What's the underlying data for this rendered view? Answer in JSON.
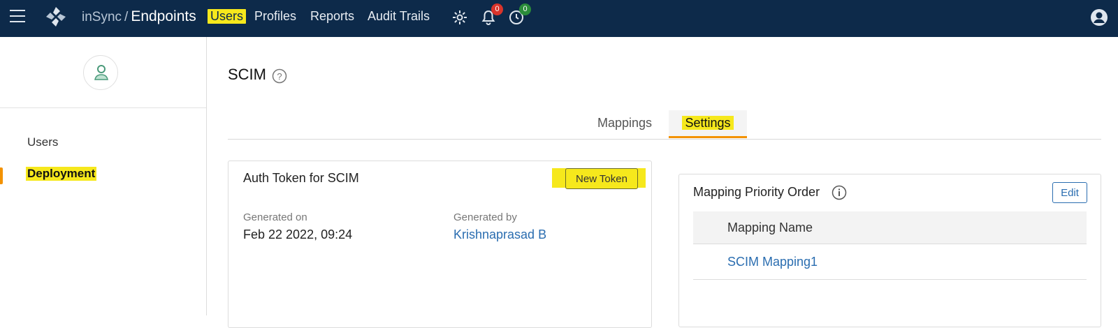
{
  "topbar": {
    "brand_prefix": "inSync",
    "brand_separator": "/",
    "brand_product": "Endpoints",
    "nav": [
      {
        "label": "Users",
        "active": true
      },
      {
        "label": "Profiles",
        "active": false
      },
      {
        "label": "Reports",
        "active": false
      },
      {
        "label": "Audit Trails",
        "active": false
      }
    ],
    "icons": {
      "menu": "hamburger-menu-icon",
      "logo": "insync-logo-icon",
      "settings": "gear-icon",
      "notifications": "bell-icon",
      "activity": "clock-icon",
      "profile": "user-avatar-icon"
    },
    "notifications_count": "0",
    "activity_count": "0",
    "colors": {
      "background": "#0d2a4a",
      "highlight": "#f6e81c",
      "badge_red": "#d9342b",
      "badge_green": "#2a8c3a"
    }
  },
  "sidebar": {
    "items": [
      {
        "label": "Users",
        "active": false
      },
      {
        "label": "Deployment",
        "active": true
      }
    ],
    "accent": "#f39200"
  },
  "main": {
    "title": "SCIM",
    "tabs": [
      {
        "label": "Mappings",
        "active": false
      },
      {
        "label": "Settings",
        "active": true
      }
    ],
    "auth_card": {
      "title": "Auth Token for SCIM",
      "button": "New Token",
      "generated_on_label": "Generated on",
      "generated_on_value": "Feb 22 2022, 09:24",
      "generated_by_label": "Generated by",
      "generated_by_value": "Krishnaprasad B"
    },
    "mapping_card": {
      "title": "Mapping Priority Order",
      "edit_button": "Edit",
      "column_header": "Mapping Name",
      "rows": [
        {
          "name": "SCIM Mapping1"
        }
      ]
    },
    "link_color": "#2a6db0"
  }
}
